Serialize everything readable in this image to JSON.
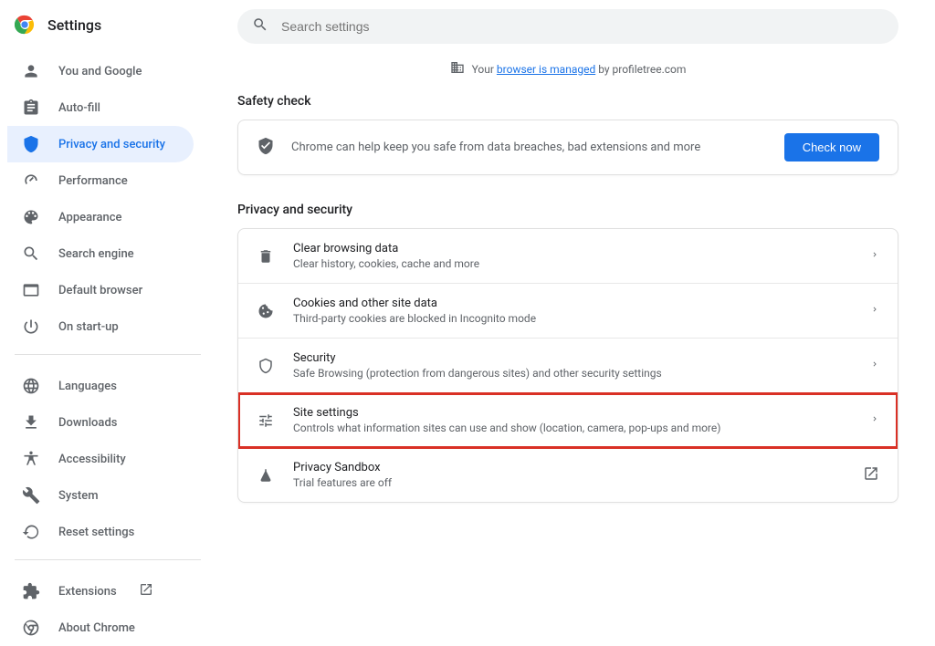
{
  "header": {
    "title": "Settings"
  },
  "search": {
    "placeholder": "Search settings"
  },
  "managed": {
    "prefix": "Your ",
    "link": "browser is managed",
    "suffix": " by profiletree.com"
  },
  "sidebar": {
    "items": [
      {
        "label": "You and Google"
      },
      {
        "label": "Auto-fill"
      },
      {
        "label": "Privacy and security"
      },
      {
        "label": "Performance"
      },
      {
        "label": "Appearance"
      },
      {
        "label": "Search engine"
      },
      {
        "label": "Default browser"
      },
      {
        "label": "On start-up"
      }
    ],
    "lower": [
      {
        "label": "Languages"
      },
      {
        "label": "Downloads"
      },
      {
        "label": "Accessibility"
      },
      {
        "label": "System"
      },
      {
        "label": "Reset settings"
      }
    ],
    "footer": [
      {
        "label": "Extensions"
      },
      {
        "label": "About Chrome"
      }
    ]
  },
  "safety": {
    "heading": "Safety check",
    "text": "Chrome can help keep you safe from data breaches, bad extensions and more",
    "button": "Check now"
  },
  "privacy": {
    "heading": "Privacy and security",
    "rows": [
      {
        "title": "Clear browsing data",
        "sub": "Clear history, cookies, cache and more"
      },
      {
        "title": "Cookies and other site data",
        "sub": "Third-party cookies are blocked in Incognito mode"
      },
      {
        "title": "Security",
        "sub": "Safe Browsing (protection from dangerous sites) and other security settings"
      },
      {
        "title": "Site settings",
        "sub": "Controls what information sites can use and show (location, camera, pop-ups and more)"
      },
      {
        "title": "Privacy Sandbox",
        "sub": "Trial features are off"
      }
    ]
  }
}
